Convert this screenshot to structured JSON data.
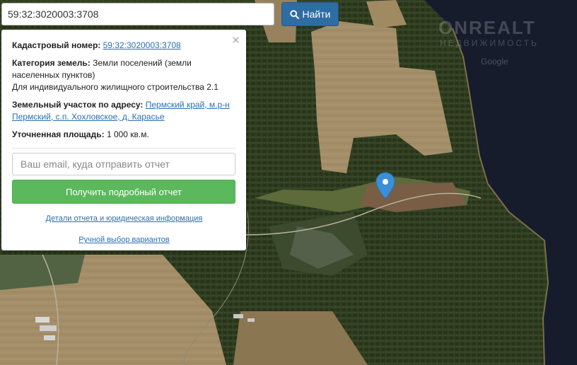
{
  "search": {
    "value": "59:32:3020003:3708",
    "button_label": "Найти",
    "button_icon": "search-icon"
  },
  "watermark": {
    "logo": "ONREALT",
    "subtitle": "НЕДВИЖИМОСТЬ",
    "google": "Google"
  },
  "info": {
    "cadastral_label": "Кадастровый номер:",
    "cadastral_value": "59:32:3020003:3708",
    "category_label": "Категория земель:",
    "category_value": "Земли поселений (земли населенных пунктов)",
    "usage": "Для индивидуального жилищного строительства 2.1",
    "address_label": "Земельный участок по адресу:",
    "address_value": "Пермский край, м.р-н Пермский, с.п. Хохловское, д. Карасье",
    "area_label": "Уточненная площадь:",
    "area_value": "1 000 кв.м."
  },
  "report": {
    "email_placeholder": "Ваш email, куда отправить отчет",
    "get_button": "Получить подробный отчет",
    "details_link": "Детали отчета и юридическая информация",
    "manual_link": "Ручной выбор вариантов"
  },
  "colors": {
    "search_button": "#2e6da4",
    "get_button": "#5cb85c",
    "marker": "#3b8fd8",
    "link": "#2a6fb3"
  }
}
